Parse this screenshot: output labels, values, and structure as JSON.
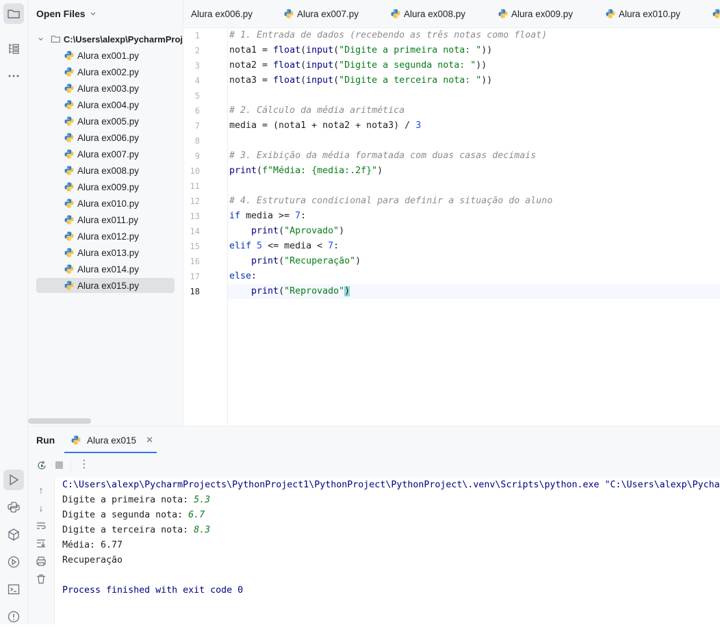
{
  "project_panel": {
    "title": "Open Files",
    "root": "C:\\Users\\alexp\\PycharmProj",
    "files": [
      "Alura ex001.py",
      "Alura ex002.py",
      "Alura ex003.py",
      "Alura ex004.py",
      "Alura ex005.py",
      "Alura ex006.py",
      "Alura ex007.py",
      "Alura ex008.py",
      "Alura ex009.py",
      "Alura ex010.py",
      "Alura ex011.py",
      "Alura ex012.py",
      "Alura ex013.py",
      "Alura ex014.py",
      "Alura ex015.py"
    ],
    "selected": "Alura ex015.py"
  },
  "tabs": [
    "Alura ex006.py",
    "Alura ex007.py",
    "Alura ex008.py",
    "Alura ex009.py",
    "Alura ex010.py"
  ],
  "editor": {
    "line_numbers": [
      "1",
      "2",
      "3",
      "4",
      "5",
      "6",
      "7",
      "8",
      "9",
      "10",
      "11",
      "12",
      "13",
      "14",
      "15",
      "16",
      "17",
      "18"
    ],
    "current_line": "18",
    "lines": [
      "# 1. Entrada de dados (recebendo as três notas como float)",
      "nota1 = float(input(\"Digite a primeira nota: \"))",
      "nota2 = float(input(\"Digite a segunda nota: \"))",
      "nota3 = float(input(\"Digite a terceira nota: \"))",
      "",
      "# 2. Cálculo da média aritmética",
      "media = (nota1 + nota2 + nota3) / 3",
      "",
      "# 3. Exibição da média formatada com duas casas decimais",
      "print(f\"Média: {media:.2f}\")",
      "",
      "# 4. Estrutura condicional para definir a situação do aluno",
      "if media >= 7:",
      "    print(\"Aprovado\")",
      "elif 5 <= media < 7:",
      "    print(\"Recuperação\")",
      "else:",
      "    print(\"Reprovado\")"
    ]
  },
  "run_panel": {
    "title": "Run",
    "tab_label": "Alura ex015",
    "output": {
      "command": "C:\\Users\\alexp\\PycharmProjects\\PythonProject1\\PythonProject\\PythonProject\\.venv\\Scripts\\python.exe \"C:\\Users\\alexp\\Pycha",
      "prompt1": "Digite a primeira nota: ",
      "input1": "5.3",
      "prompt2": "Digite a segunda nota: ",
      "input2": "6.7",
      "prompt3": "Digite a terceira nota: ",
      "input3": "8.3",
      "media": "Média: 6.77",
      "result": "Recuperação",
      "exit": "Process finished with exit code 0"
    }
  },
  "colors": {
    "accent": "#3574f0",
    "selection": "#dfe1e5",
    "keyword": "#0033b3",
    "string": "#067d17",
    "comment": "#8c8c8c",
    "number": "#1750eb"
  }
}
